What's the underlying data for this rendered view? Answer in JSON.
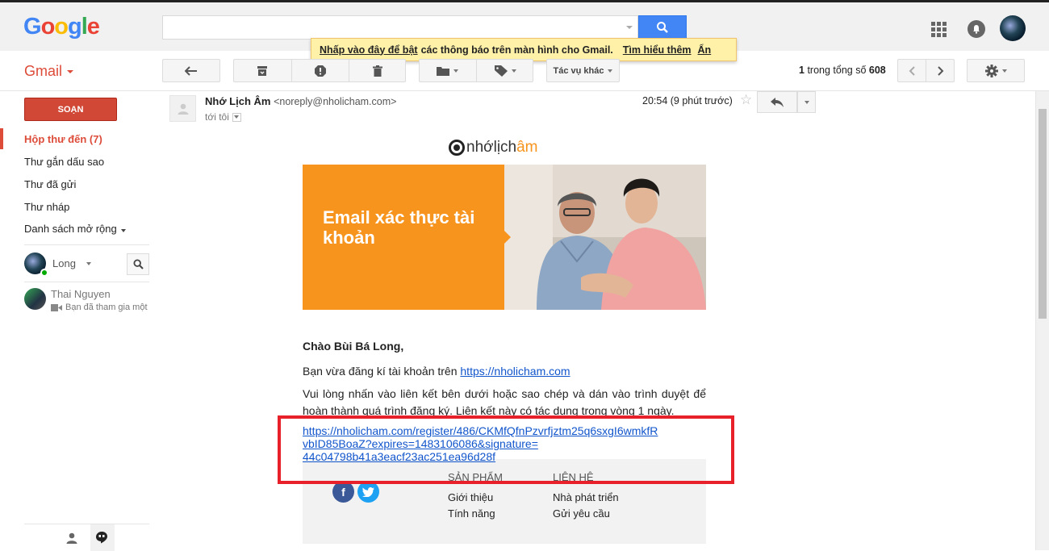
{
  "header": {
    "logo_letters": [
      "G",
      "o",
      "o",
      "g",
      "l",
      "e"
    ],
    "logo_colors": [
      "#4285f4",
      "#ea4335",
      "#fbbc05",
      "#4285f4",
      "#34a853",
      "#ea4335"
    ],
    "search_value": "",
    "icons": [
      "search-icon",
      "apps-icon",
      "notifications-icon",
      "account-avatar"
    ]
  },
  "notification": {
    "enable_text": "Nhấp vào đây để bật",
    "rest_text": "các thông báo trên màn hình cho Gmail.",
    "learn_more": "Tìm hiểu thêm",
    "hide": "Ẩn"
  },
  "toolbar": {
    "gmail_label": "Gmail",
    "more_actions": "Tác vụ khác",
    "count_first": "1",
    "count_text": "trong tổng số",
    "count_total": "608"
  },
  "sidebar": {
    "compose": "SOẠN",
    "items": [
      {
        "label": "Hộp thư đến (7)",
        "active": true
      },
      {
        "label": "Thư gắn dấu sao",
        "active": false
      },
      {
        "label": "Thư đã gửi",
        "active": false
      },
      {
        "label": "Thư nháp",
        "active": false
      },
      {
        "label": "Danh sách mở rộng",
        "active": false
      }
    ],
    "chat_user": "Long",
    "contact_name": "Thai Nguyen",
    "contact_status": "Bạn đã tham gia một"
  },
  "message": {
    "sender_name": "Nhớ Lịch Âm",
    "sender_email": "<noreply@nholicham.com>",
    "to": "tới tôi",
    "time": "20:54 (9 phút trước)"
  },
  "email": {
    "brand_pre": "nhớlịch",
    "brand_am": "âm",
    "banner_title": "Email xác thực tài khoản",
    "greeting": "Chào Bùi Bá Long,",
    "line1_pre": "Bạn vừa đăng kí tài khoản trên",
    "line1_link": "https://nholicham.com",
    "line2": "Vui lòng nhấn vào liên kết bên dưới hoặc sao chép và dán vào trình duyệt để hoàn thành quá trình đăng ký. Liên kết này có tác dụng trong vòng 1 ngày.",
    "verify_link_1": "https://nholicham.com/register/486/CKMfQfnPzvrfjztm25q6sxgI6wmkfR",
    "verify_link_2": "vbID85BoaZ?expires=1483106086&signature=",
    "verify_link_3": "44c04798b41a3eacf23ac251ea96d28f"
  },
  "footer": {
    "products_head": "SẢN PHẨM",
    "contact_head": "LIÊN HỆ",
    "products": [
      "Giới thiệu",
      "Tính năng"
    ],
    "contacts": [
      "Nhà phát triển",
      "Gửi yêu cầu"
    ]
  },
  "colors": {
    "accent_red": "#dd4b39",
    "brand_orange": "#f7941d",
    "highlight_box": "#e8202a",
    "link_blue": "#1155cc"
  }
}
